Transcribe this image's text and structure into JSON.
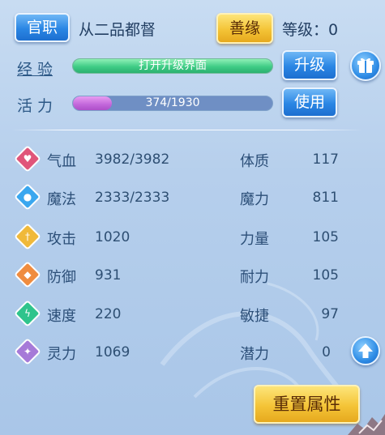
{
  "header": {
    "title_button": "官职",
    "rank_text": "从二品都督",
    "karma_button": "善缘",
    "level_label": "等级：0"
  },
  "experience": {
    "label": "经 验",
    "bar_text": "打开升级界面",
    "upgrade_button": "升级",
    "fill_fraction": 1.0
  },
  "vitality": {
    "label": "活 力",
    "bar_text": "374/1930",
    "use_button": "使用",
    "current": 374,
    "max": 1930
  },
  "stats": [
    {
      "name": "气血",
      "value": "3982/3982",
      "icon": "heart-icon",
      "color": "#e0557a"
    },
    {
      "name": "魔法",
      "value": "2333/2333",
      "icon": "mana-icon",
      "color": "#3aa7ef"
    },
    {
      "name": "攻击",
      "value": "1020",
      "icon": "sword-icon",
      "color": "#f0b93a"
    },
    {
      "name": "防御",
      "value": "931",
      "icon": "shield-icon",
      "color": "#ef8c3f"
    },
    {
      "name": "速度",
      "value": "220",
      "icon": "bolt-icon",
      "color": "#2fc48c"
    },
    {
      "name": "灵力",
      "value": "1069",
      "icon": "spirit-icon",
      "color": "#a67ad8"
    }
  ],
  "attributes": [
    {
      "name": "体质",
      "value": "117"
    },
    {
      "name": "魔力",
      "value": "811"
    },
    {
      "name": "力量",
      "value": "105"
    },
    {
      "name": "耐力",
      "value": "105"
    },
    {
      "name": "敏捷",
      "value": "97"
    },
    {
      "name": "潜力",
      "value": "0"
    }
  ],
  "reset_button": "重置属性"
}
